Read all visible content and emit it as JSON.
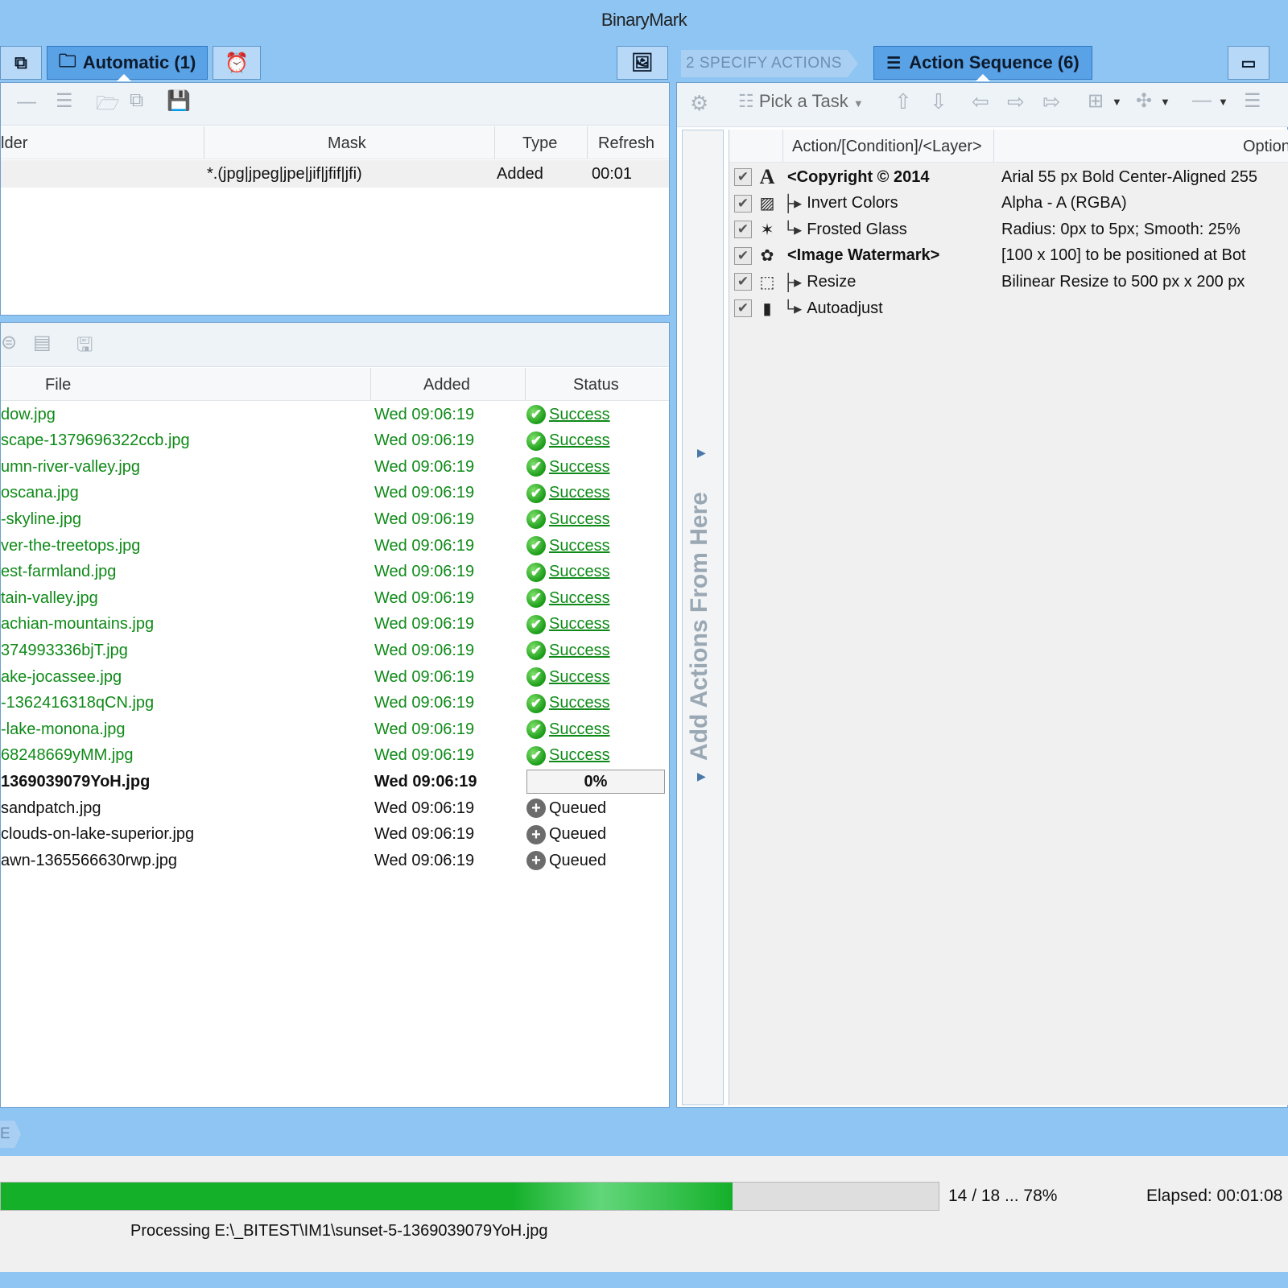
{
  "window": {
    "brand": "BinaryMark"
  },
  "left_tabs": {
    "automatic_label": "Automatic (1)"
  },
  "right_header": {
    "step_label": "2  SPECIFY ACTIONS",
    "action_sequence_label": "Action Sequence (6)"
  },
  "watch_table": {
    "columns": [
      "lder",
      "Mask",
      "Type",
      "Refresh"
    ],
    "rows": [
      {
        "folder": "",
        "mask": "*.(jpg|jpeg|jpe|jif|jfif|jfi)",
        "type": "Added",
        "refresh": "00:01"
      }
    ]
  },
  "file_table": {
    "columns": [
      "File",
      "Added",
      "Status"
    ],
    "rows": [
      {
        "file": "dow.jpg",
        "added": "Wed 09:06:19",
        "status": "Success",
        "state": "success"
      },
      {
        "file": "scape-1379696322ccb.jpg",
        "added": "Wed 09:06:19",
        "status": "Success",
        "state": "success"
      },
      {
        "file": "umn-river-valley.jpg",
        "added": "Wed 09:06:19",
        "status": "Success",
        "state": "success"
      },
      {
        "file": "oscana.jpg",
        "added": "Wed 09:06:19",
        "status": "Success",
        "state": "success"
      },
      {
        "file": "-skyline.jpg",
        "added": "Wed 09:06:19",
        "status": "Success",
        "state": "success"
      },
      {
        "file": "ver-the-treetops.jpg",
        "added": "Wed 09:06:19",
        "status": "Success",
        "state": "success"
      },
      {
        "file": "est-farmland.jpg",
        "added": "Wed 09:06:19",
        "status": "Success",
        "state": "success"
      },
      {
        "file": "tain-valley.jpg",
        "added": "Wed 09:06:19",
        "status": "Success",
        "state": "success"
      },
      {
        "file": "achian-mountains.jpg",
        "added": "Wed 09:06:19",
        "status": "Success",
        "state": "success"
      },
      {
        "file": "374993336bjT.jpg",
        "added": "Wed 09:06:19",
        "status": "Success",
        "state": "success"
      },
      {
        "file": "ake-jocassee.jpg",
        "added": "Wed 09:06:19",
        "status": "Success",
        "state": "success"
      },
      {
        "file": "-1362416318qCN.jpg",
        "added": "Wed 09:06:19",
        "status": "Success",
        "state": "success"
      },
      {
        "file": "-lake-monona.jpg",
        "added": "Wed 09:06:19",
        "status": "Success",
        "state": "success"
      },
      {
        "file": "68248669yMM.jpg",
        "added": "Wed 09:06:19",
        "status": "Success",
        "state": "success"
      },
      {
        "file": "1369039079YoH.jpg",
        "added": "Wed 09:06:19",
        "status": "0%",
        "state": "processing"
      },
      {
        "file": "sandpatch.jpg",
        "added": "Wed 09:06:19",
        "status": "Queued",
        "state": "queued"
      },
      {
        "file": "clouds-on-lake-superior.jpg",
        "added": "Wed 09:06:19",
        "status": "Queued",
        "state": "queued"
      },
      {
        "file": "awn-1365566630rwp.jpg",
        "added": "Wed 09:06:19",
        "status": "Queued",
        "state": "queued"
      }
    ]
  },
  "actions_toolbar": {
    "pick_task_label": "Pick a Task"
  },
  "actions_table": {
    "columns": [
      "Action/[Condition]/<Layer>",
      "Option"
    ],
    "rows": [
      {
        "icon": "text-icon",
        "glyph": "A",
        "name": "<Copyright © 2014",
        "prefix": "",
        "bold": true,
        "option": "Arial  55  px  Bold  Center-Aligned  255"
      },
      {
        "icon": "picture-icon",
        "glyph": "▨",
        "name": "Invert Colors",
        "prefix": "├▸",
        "bold": false,
        "option": "Alpha - A (RGBA)"
      },
      {
        "icon": "magic-wand-icon",
        "glyph": "✶",
        "name": "Frosted Glass",
        "prefix": "└▸",
        "bold": false,
        "option": "Radius: 0px to 5px;  Smooth: 25%"
      },
      {
        "icon": "paw-icon",
        "glyph": "✿",
        "name": "<Image Watermark>",
        "prefix": "",
        "bold": true,
        "option": "[100  x  100]  to  be  positioned  at  Bot"
      },
      {
        "icon": "resize-icon",
        "glyph": "⬚",
        "name": "Resize",
        "prefix": "├▸",
        "bold": false,
        "option": "Bilinear Resize to 500 px x 200 px"
      },
      {
        "icon": "histogram-icon",
        "glyph": "▮",
        "name": "Autoadjust",
        "prefix": "└▸",
        "bold": false,
        "option": ""
      }
    ]
  },
  "side_strip": {
    "label": "Add Actions From Here"
  },
  "bottom_crumb": {
    "label": "E"
  },
  "progress": {
    "fraction": 0.78,
    "counter": "14 / 18 ... 78%",
    "elapsed": "Elapsed: 00:01:08",
    "status_text": "Processing E:\\_BITEST\\IM1\\sunset-5-1369039079YoH.jpg"
  }
}
